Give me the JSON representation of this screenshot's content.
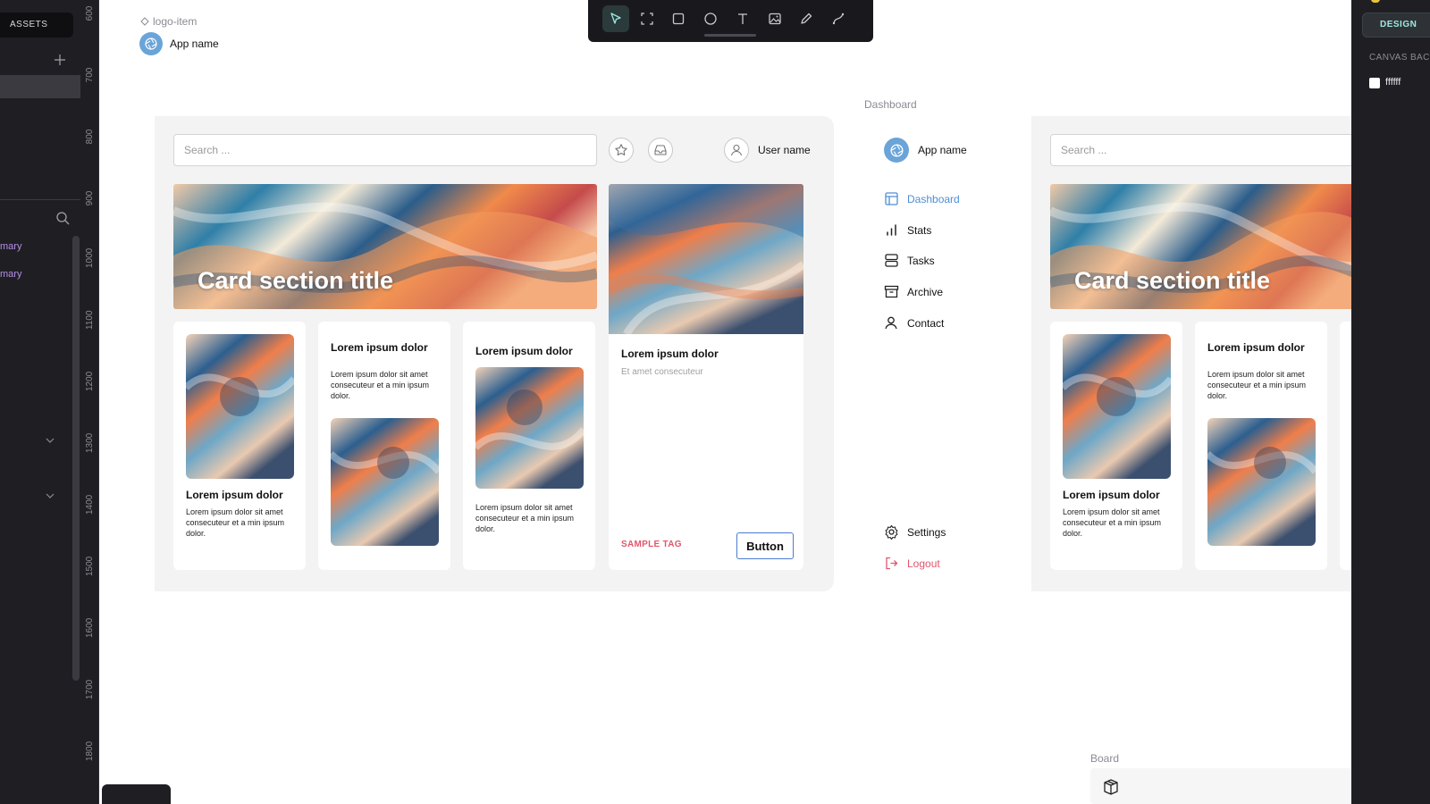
{
  "left_panel": {
    "assets_tab": "ASSETS",
    "layers": [
      "mary",
      "mary"
    ]
  },
  "ruler": {
    "labels": [
      "600",
      "700",
      "800",
      "900",
      "1000",
      "1100",
      "1200",
      "1300",
      "1400",
      "1500",
      "1600",
      "1700",
      "1800"
    ]
  },
  "toolbar": {
    "tools": [
      "move-tool",
      "frame-tool",
      "rectangle-tool",
      "ellipse-tool",
      "text-tool",
      "image-tool",
      "pencil-tool",
      "path-tool"
    ],
    "active": "move-tool"
  },
  "logo_component": {
    "label": "logo-item",
    "app_name": "App name"
  },
  "board_1": {
    "search_placeholder": "Search ...",
    "user_name": "User name",
    "hero_title": "Card section title",
    "cards": [
      {
        "title": "Lorem ipsum dolor",
        "text": "Lorem ipsum dolor sit amet consecuteur et a min ipsum dolor."
      },
      {
        "title": "Lorem ipsum dolor",
        "text": "Lorem ipsum dolor sit amet consecuteur et a min ipsum dolor."
      },
      {
        "title": "Lorem ipsum dolor",
        "text": "Lorem ipsum dolor sit amet consecuteur et a min ipsum dolor."
      }
    ],
    "feature_card": {
      "title": "Lorem ipsum dolor",
      "subtitle": "Et amet consecuteur",
      "tag": "SAMPLE TAG",
      "button": "Button"
    }
  },
  "dashboard": {
    "label": "Dashboard",
    "app_name": "App name",
    "nav": [
      {
        "label": "Dashboard",
        "icon": "layout-icon",
        "active": true
      },
      {
        "label": "Stats",
        "icon": "bar-chart-icon"
      },
      {
        "label": "Tasks",
        "icon": "server-icon"
      },
      {
        "label": "Archive",
        "icon": "archive-icon"
      },
      {
        "label": "Contact",
        "icon": "user-icon"
      }
    ],
    "settings": "Settings",
    "logout": "Logout"
  },
  "board_2": {
    "search_placeholder": "Search ...",
    "hero_title": "Card section title",
    "cards": [
      {
        "title": "Lorem ipsum dolor",
        "text": "Lorem ipsum dolor sit amet consecuteur et a min ipsum dolor."
      },
      {
        "title": "Lorem ipsum dolor",
        "text": "Lorem ipsum dolor sit amet consecuteur et a min ipsum dolor."
      }
    ]
  },
  "board_label": "Board",
  "right_panel": {
    "tab": "DESIGN",
    "canvas_background_label": "CANVAS BACK",
    "canvas_background_value": "ffffff"
  },
  "colors": {
    "accent": "#4f8ed6",
    "danger": "#e0566b",
    "panel": "#1f1f23",
    "board": "#f3f3f3"
  }
}
